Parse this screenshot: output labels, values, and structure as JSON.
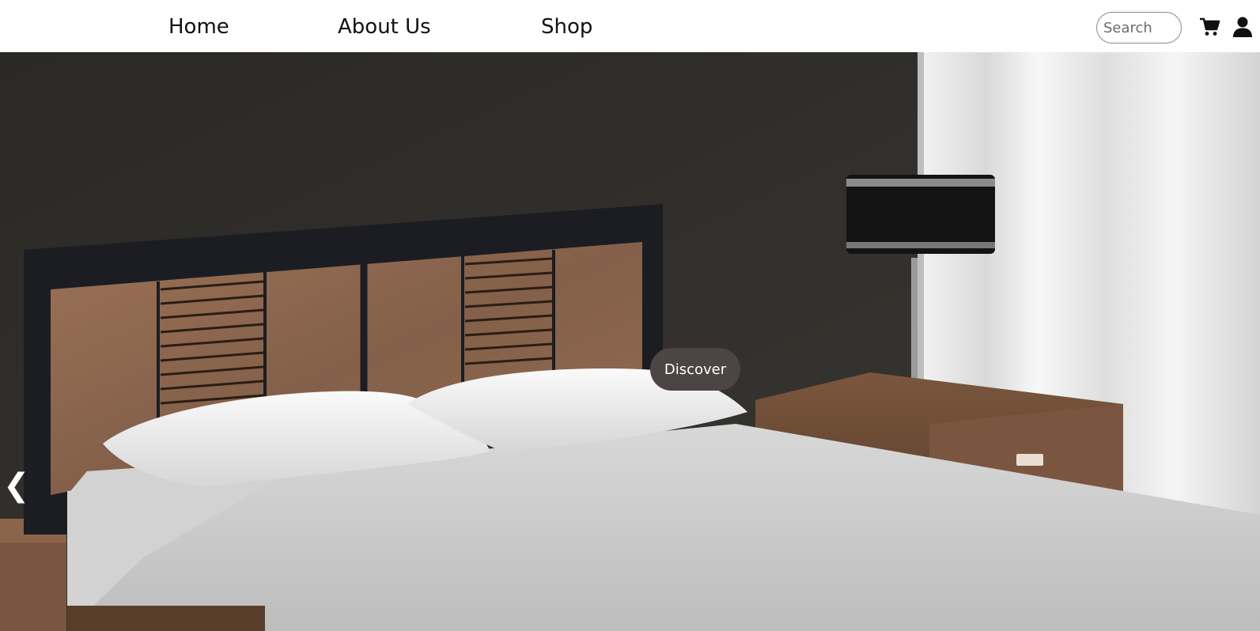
{
  "nav": {
    "home_label": "Home",
    "about_label": "About Us",
    "shop_label": "Shop"
  },
  "search": {
    "placeholder": "Search"
  },
  "icons": {
    "cart": "shopping-cart-icon",
    "user": "user-account-icon"
  },
  "hero": {
    "image_subject": "bedroom-bed-nightstand-lamp",
    "prev_label": "❮",
    "discover_label": "Discover",
    "colors": {
      "wall": "#2f2c29",
      "headboard_frame": "#1b1d22",
      "wood": "#8a6346",
      "sheet": "#c9c9c9",
      "curtain": "#ececec",
      "button": "#4d4545"
    }
  }
}
